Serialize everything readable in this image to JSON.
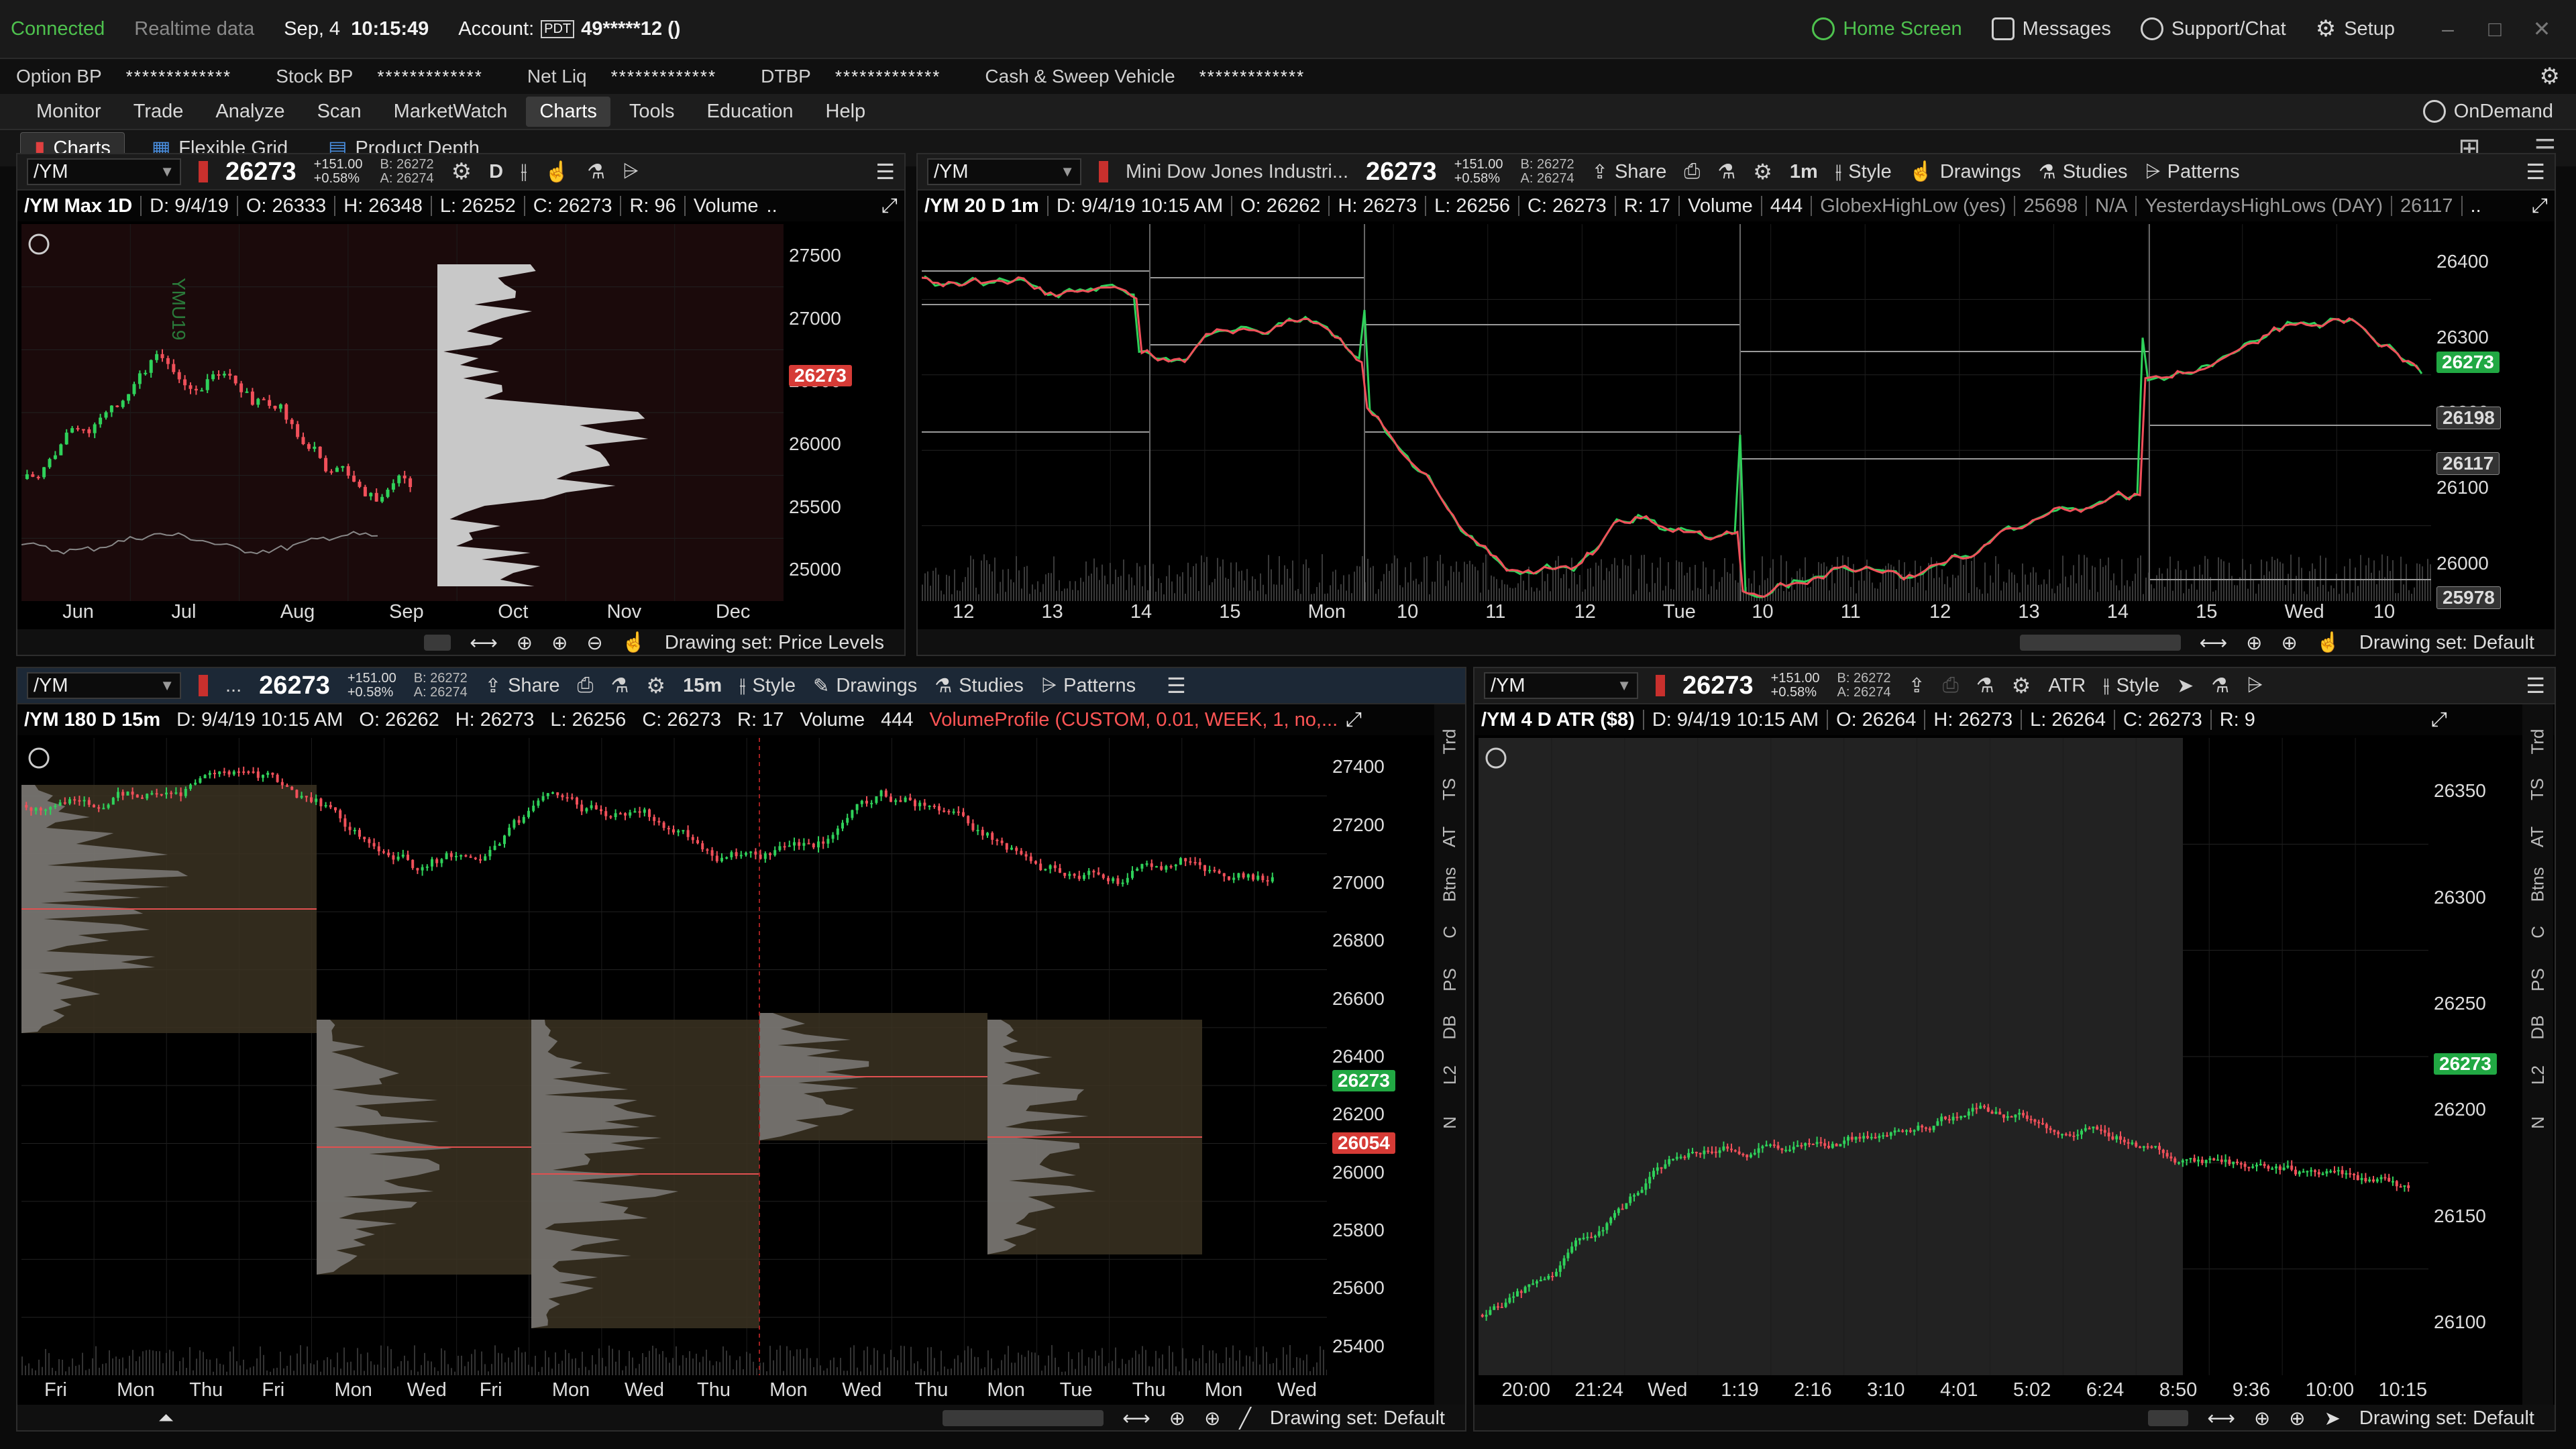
{
  "status": {
    "connected": "Connected",
    "realtime": "Realtime data",
    "date": "Sep, 4",
    "time": "10:15:49",
    "account_label": "Account:",
    "account_badge": "PDT",
    "account_num": "49*****12 ()",
    "home": "Home Screen",
    "messages": "Messages",
    "support": "Support/Chat",
    "setup": "Setup"
  },
  "bp": {
    "option_label": "Option BP",
    "option_val": "*************",
    "stock_label": "Stock BP",
    "stock_val": "*************",
    "netliq_label": "Net Liq",
    "netliq_val": "*************",
    "dtbp_label": "DTBP",
    "dtbp_val": "*************",
    "cash_label": "Cash & Sweep Vehicle",
    "cash_val": "*************"
  },
  "menu": {
    "items": [
      "Monitor",
      "Trade",
      "Analyze",
      "Scan",
      "MarketWatch",
      "Charts",
      "Tools",
      "Education",
      "Help"
    ],
    "ondemand": "OnDemand"
  },
  "subtabs": {
    "charts": "Charts",
    "grid": "Flexible Grid",
    "depth": "Product Depth"
  },
  "colors": {
    "up": "#2fd15a",
    "down": "#f0505a",
    "price_tag": "#21a843",
    "tag_red": "#d63b36"
  },
  "p1": {
    "symbol": "/YM",
    "price": "26273",
    "chg1": "+151.00",
    "chg2": "+0.58%",
    "bid": "B: 26272",
    "ask": "A: 26274",
    "agg": "D",
    "ind": {
      "title": "/YM Max 1D",
      "d": "D: 9/4/19",
      "o": "O: 26333",
      "h": "H: 26348",
      "l": "L: 26252",
      "c": "C: 26273",
      "r": "R: 96",
      "vol": "Volume",
      "more": ".."
    },
    "yticks": [
      "27500",
      "27000",
      "26500",
      "26000",
      "25500",
      "25000"
    ],
    "tag": "26273",
    "xticks": [
      "Jun",
      "Jul",
      "Aug",
      "Sep",
      "Oct",
      "Nov",
      "Dec"
    ],
    "drawing": "Drawing set: Price Levels"
  },
  "p2": {
    "symbol": "/YM",
    "desc": "Mini Dow Jones Industri...",
    "price": "26273",
    "chg1": "+151.00",
    "chg2": "+0.58%",
    "bid": "B: 26272",
    "ask": "A: 26274",
    "agg": "1m",
    "style": "Style",
    "drawings": "Drawings",
    "studies": "Studies",
    "patterns": "Patterns",
    "share": "Share",
    "ind": {
      "title": "/YM 20 D 1m",
      "d": "D: 9/4/19 10:15 AM",
      "o": "O: 26262",
      "h": "H: 26273",
      "l": "L: 26256",
      "c": "C: 26273",
      "r": "R: 17",
      "vol": "Volume",
      "volv": "444",
      "s1": "GlobexHighLow (yes)",
      "s1v": "25698",
      "s1n": "N/A",
      "s2": "YesterdaysHighLows (DAY)",
      "s2v": "26117",
      "more": ".."
    },
    "yticks": [
      "26400",
      "26300",
      "26200",
      "26100",
      "26000"
    ],
    "tags": [
      "26273",
      "26198",
      "26117",
      "25978"
    ],
    "xticks": [
      "12",
      "13",
      "14",
      "15",
      "Mon",
      "10",
      "11",
      "12",
      "Tue",
      "10",
      "11",
      "12",
      "13",
      "14",
      "15",
      "Wed",
      "10"
    ],
    "drawing": "Drawing set: Default"
  },
  "p3": {
    "symbol": "/YM",
    "dots": "...",
    "price": "26273",
    "chg1": "+151.00",
    "chg2": "+0.58%",
    "bid": "B: 26272",
    "ask": "A: 26274",
    "agg": "15m",
    "style": "Style",
    "drawings": "Drawings",
    "studies": "Studies",
    "patterns": "Patterns",
    "share": "Share",
    "ind": {
      "title": "/YM 180 D 15m",
      "d": "D: 9/4/19 10:15 AM",
      "o": "O: 26262",
      "h": "H: 26273",
      "l": "L: 26256",
      "c": "C: 26273",
      "r": "R: 17",
      "vol": "Volume",
      "volv": "444",
      "vp": "VolumeProfile (CUSTOM, 0.01, WEEK, 1, no,..."
    },
    "yticks": [
      "27400",
      "27200",
      "27000",
      "26800",
      "26600",
      "26400",
      "26200",
      "26000",
      "25800",
      "25600",
      "25400"
    ],
    "tags": [
      "26273",
      "26054"
    ],
    "xticks": [
      "Fri",
      "Mon",
      "Thu",
      "Fri",
      "Mon",
      "Wed",
      "Fri",
      "Mon",
      "Wed",
      "Thu",
      "Mon",
      "Wed",
      "Thu",
      "Mon",
      "Tue",
      "Thu",
      "Mon",
      "Wed"
    ],
    "drawing": "Drawing set: Default"
  },
  "p4": {
    "symbol": "/YM",
    "price": "26273",
    "chg1": "+151.00",
    "chg2": "+0.58%",
    "bid": "B: 26272",
    "ask": "A: 26274",
    "agg": "ATR",
    "style": "Style",
    "ind": {
      "title": "/YM 4 D ATR ($8)",
      "d": "D: 9/4/19 10:15 AM",
      "o": "O: 26264",
      "h": "H: 26273",
      "l": "L: 26264",
      "c": "C: 26273",
      "r": "R: 9"
    },
    "yticks": [
      "26350",
      "26300",
      "26250",
      "26200",
      "26150",
      "26100"
    ],
    "tag": "26273",
    "xticks": [
      "20:00",
      "21:24",
      "Wed",
      "1:19",
      "2:16",
      "3:10",
      "4:01",
      "5:02",
      "6:24",
      "8:50",
      "9:36",
      "10:00",
      "10:15"
    ],
    "drawing": "Drawing set: Default"
  },
  "sidebar": [
    "Trd",
    "TS",
    "AT",
    "Btns",
    "C",
    "PS",
    "DB",
    "L2",
    "N"
  ]
}
